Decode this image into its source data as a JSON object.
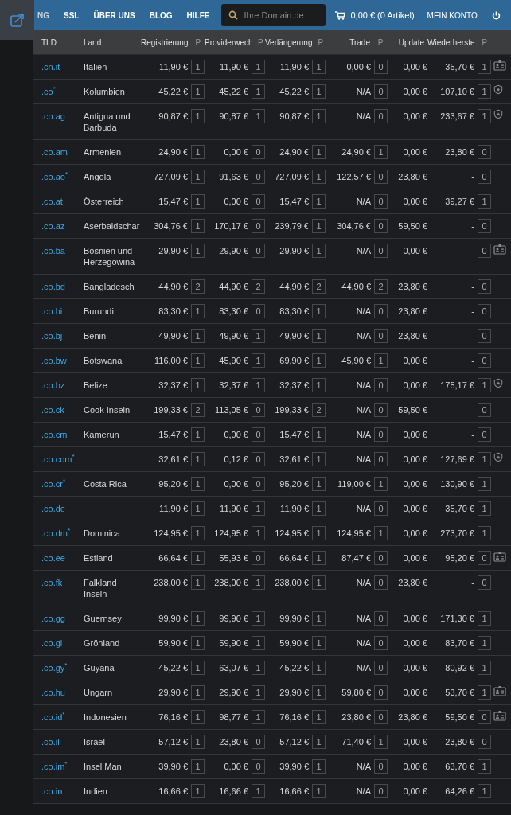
{
  "nav": {
    "items": [
      "NG",
      "SSL",
      "ÜBER UNS",
      "BLOG",
      "HILFE"
    ],
    "search": {
      "placeholder": "Ihre Domain.de"
    },
    "cart": "0,00 € (0 Artikel)",
    "account": "MEIN KONTO"
  },
  "table": {
    "columns": [
      {
        "label": "TLD",
        "kind": "text"
      },
      {
        "label": "Land",
        "kind": "text"
      },
      {
        "label": "Registrierung",
        "p": "P",
        "kind": "price"
      },
      {
        "label": "Providerwech",
        "p": "P",
        "kind": "price"
      },
      {
        "label": "Verlängerung",
        "p": "P",
        "kind": "price"
      },
      {
        "label": "Trade",
        "p": "P",
        "kind": "price"
      },
      {
        "label": "Update",
        "kind": "plain"
      },
      {
        "label": "Wiederherste",
        "p": "P",
        "kind": "price"
      }
    ],
    "rows": [
      {
        "tld": ".cn.it",
        "land": "Italien",
        "prices": [
          [
            "11,90 €",
            "1"
          ],
          [
            "11,90 €",
            "1"
          ],
          [
            "11,90 €",
            "1"
          ],
          [
            "0,00 €",
            "0"
          ]
        ],
        "update": "0,00 €",
        "restore": [
          "35,70 €",
          "1"
        ],
        "kind": "card"
      },
      {
        "tld": ".co$^{*}$",
        "land": "Kolumbien",
        "prices": [
          [
            "45,22 €",
            "1"
          ],
          [
            "45,22 €",
            "1"
          ],
          [
            "45,22 €",
            "1"
          ],
          [
            "N/A",
            "0"
          ]
        ],
        "update": "0,00 €",
        "restore": [
          "107,10 €",
          "1"
        ],
        "kind": "shield"
      },
      {
        "tld": ".co.ag",
        "land": "Antigua und Barbuda",
        "prices": [
          [
            "90,87 €",
            "1"
          ],
          [
            "90,87 €",
            "1"
          ],
          [
            "90,87 €",
            "1"
          ],
          [
            "N/A",
            "0"
          ]
        ],
        "update": "0,00 €",
        "restore": [
          "233,67 €",
          "1"
        ],
        "kind": "shield"
      },
      {
        "tld": ".co.am",
        "land": "Armenien",
        "prices": [
          [
            "24,90 €",
            "1"
          ],
          [
            "0,00 €",
            "0"
          ],
          [
            "24,90 €",
            "1"
          ],
          [
            "24,90 €",
            "1"
          ]
        ],
        "update": "0,00 €",
        "restore": [
          "23,80 €",
          "0"
        ],
        "kind": "plain"
      },
      {
        "tld": ".co.ao$^{*}$",
        "land": "Angola",
        "prices": [
          [
            "727,09 €",
            "1"
          ],
          [
            "91,63 €",
            "0"
          ],
          [
            "727,09 €",
            "1"
          ],
          [
            "122,57 €",
            "0"
          ]
        ],
        "update": "23,80 €",
        "restore": [
          "-",
          "0"
        ],
        "kind": "plain"
      },
      {
        "tld": ".co.at",
        "land": "Österreich",
        "prices": [
          [
            "15,47 €",
            "1"
          ],
          [
            "0,00 €",
            "0"
          ],
          [
            "15,47 €",
            "1"
          ],
          [
            "N/A",
            "0"
          ]
        ],
        "update": "0,00 €",
        "restore": [
          "39,27 €",
          "1"
        ],
        "kind": "plain"
      },
      {
        "tld": ".co.az",
        "land": "Aserbaidschar",
        "prices": [
          [
            "304,76 €",
            "1"
          ],
          [
            "170,17 €",
            "0"
          ],
          [
            "239,79 €",
            "1"
          ],
          [
            "304,76 €",
            "0"
          ]
        ],
        "update": "59,50 €",
        "restore": [
          "-",
          "0"
        ],
        "kind": "plain"
      },
      {
        "tld": ".co.ba",
        "land": "Bosnien und Herzegowina",
        "prices": [
          [
            "29,90 €",
            "1"
          ],
          [
            "29,90 €",
            "0"
          ],
          [
            "29,90 €",
            "1"
          ],
          [
            "N/A",
            "0"
          ]
        ],
        "update": "0,00 €",
        "restore": [
          "-",
          "0"
        ],
        "kind": "card"
      },
      {
        "tld": ".co.bd",
        "land": "Bangladesch",
        "prices": [
          [
            "44,90 €",
            "2"
          ],
          [
            "44,90 €",
            "2"
          ],
          [
            "44,90 €",
            "2"
          ],
          [
            "44,90 €",
            "2"
          ]
        ],
        "update": "23,80 €",
        "restore": [
          "-",
          "0"
        ],
        "kind": "plain"
      },
      {
        "tld": ".co.bi",
        "land": "Burundi",
        "prices": [
          [
            "83,30 €",
            "1"
          ],
          [
            "83,30 €",
            "0"
          ],
          [
            "83,30 €",
            "1"
          ],
          [
            "N/A",
            "0"
          ]
        ],
        "update": "23,80 €",
        "restore": [
          "-",
          "0"
        ],
        "kind": "plain"
      },
      {
        "tld": ".co.bj",
        "land": "Benin",
        "prices": [
          [
            "49,90 €",
            "1"
          ],
          [
            "49,90 €",
            "1"
          ],
          [
            "49,90 €",
            "1"
          ],
          [
            "N/A",
            "0"
          ]
        ],
        "update": "23,80 €",
        "restore": [
          "-",
          "0"
        ],
        "kind": "plain"
      },
      {
        "tld": ".co.bw",
        "land": "Botswana",
        "prices": [
          [
            "116,00 €",
            "1"
          ],
          [
            "45,90 €",
            "1"
          ],
          [
            "69,90 €",
            "1"
          ],
          [
            "45,90 €",
            "1"
          ]
        ],
        "update": "0,00 €",
        "restore": [
          "-",
          "0"
        ],
        "kind": "plain"
      },
      {
        "tld": ".co.bz",
        "land": "Belize",
        "prices": [
          [
            "32,37 €",
            "1"
          ],
          [
            "32,37 €",
            "1"
          ],
          [
            "32,37 €",
            "1"
          ],
          [
            "N/A",
            "0"
          ]
        ],
        "update": "0,00 €",
        "restore": [
          "175,17 €",
          "1"
        ],
        "kind": "shield"
      },
      {
        "tld": ".co.ck",
        "land": "Cook Inseln",
        "prices": [
          [
            "199,33 €",
            "2"
          ],
          [
            "113,05 €",
            "0"
          ],
          [
            "199,33 €",
            "2"
          ],
          [
            "N/A",
            "0"
          ]
        ],
        "update": "59,50 €",
        "restore": [
          "-",
          "0"
        ],
        "kind": "plain"
      },
      {
        "tld": ".co.cm",
        "land": "Kamerun",
        "prices": [
          [
            "15,47 €",
            "1"
          ],
          [
            "0,00 €",
            "0"
          ],
          [
            "15,47 €",
            "1"
          ],
          [
            "N/A",
            "0"
          ]
        ],
        "update": "0,00 €",
        "restore": [
          "-",
          "0"
        ],
        "kind": "plain"
      },
      {
        "tld": ".co.com$^{*}$",
        "prices": [
          [
            "32,61 €",
            "1"
          ],
          [
            "0,12 €",
            "0"
          ],
          [
            "32,61 €",
            "1"
          ],
          [
            "N/A",
            "0"
          ]
        ],
        "update": "0,00 €",
        "restore": [
          "127,69 €",
          "1"
        ],
        "kind": "shield"
      },
      {
        "tld": ".co.cr$^{*}$",
        "land": "Costa Rica",
        "prices": [
          [
            "95,20 €",
            "1"
          ],
          [
            "0,00 €",
            "0"
          ],
          [
            "95,20 €",
            "1"
          ],
          [
            "119,00 €",
            "1"
          ]
        ],
        "update": "0,00 €",
        "restore": [
          "130,90 €",
          "1"
        ],
        "kind": "plain"
      },
      {
        "tld": ".co.de",
        "prices": [
          [
            "11,90 €",
            "1"
          ],
          [
            "11,90 €",
            "1"
          ],
          [
            "11,90 €",
            "1"
          ],
          [
            "N/A",
            "0"
          ]
        ],
        "update": "0,00 €",
        "restore": [
          "35,70 €",
          "1"
        ],
        "kind": "plain"
      },
      {
        "tld": ".co.dm$^{*}$",
        "land": "Dominica",
        "prices": [
          [
            "124,95 €",
            "1"
          ],
          [
            "124,95 €",
            "1"
          ],
          [
            "124,95 €",
            "1"
          ],
          [
            "124,95 €",
            "1"
          ]
        ],
        "update": "0,00 €",
        "restore": [
          "273,70 €",
          "1"
        ],
        "kind": "plain"
      },
      {
        "tld": ".co.ee",
        "land": "Estland",
        "prices": [
          [
            "66,64 €",
            "1"
          ],
          [
            "55,93 €",
            "0"
          ],
          [
            "66,64 €",
            "1"
          ],
          [
            "87,47 €",
            "0"
          ]
        ],
        "update": "0,00 €",
        "restore": [
          "95,20 €",
          "0"
        ],
        "kind": "card"
      },
      {
        "tld": ".co.fk",
        "land": "Falkland Inseln",
        "prices": [
          [
            "238,00 €",
            "1"
          ],
          [
            "238,00 €",
            "1"
          ],
          [
            "238,00 €",
            "1"
          ],
          [
            "N/A",
            "0"
          ]
        ],
        "update": "23,80 €",
        "restore": [
          "-",
          "0"
        ],
        "kind": "plain"
      },
      {
        "tld": ".co.gg",
        "land": "Guernsey",
        "prices": [
          [
            "99,90 €",
            "1"
          ],
          [
            "99,90 €",
            "1"
          ],
          [
            "99,90 €",
            "1"
          ],
          [
            "N/A",
            "0"
          ]
        ],
        "update": "0,00 €",
        "restore": [
          "171,30 €",
          "1"
        ],
        "kind": "plain"
      },
      {
        "tld": ".co.gl",
        "land": "Grönland",
        "prices": [
          [
            "59,90 €",
            "1"
          ],
          [
            "59,90 €",
            "1"
          ],
          [
            "59,90 €",
            "1"
          ],
          [
            "N/A",
            "0"
          ]
        ],
        "update": "0,00 €",
        "restore": [
          "83,70 €",
          "1"
        ],
        "kind": "plain"
      },
      {
        "tld": ".co.gy$^{*}$",
        "land": "Guyana",
        "prices": [
          [
            "45,22 €",
            "1"
          ],
          [
            "63,07 €",
            "1"
          ],
          [
            "45,22 €",
            "1"
          ],
          [
            "N/A",
            "0"
          ]
        ],
        "update": "0,00 €",
        "restore": [
          "80,92 €",
          "1"
        ],
        "kind": "plain"
      },
      {
        "tld": ".co.hu",
        "land": "Ungarn",
        "prices": [
          [
            "29,90 €",
            "1"
          ],
          [
            "29,90 €",
            "1"
          ],
          [
            "29,90 €",
            "1"
          ],
          [
            "59,80 €",
            "0"
          ]
        ],
        "update": "0,00 €",
        "restore": [
          "53,70 €",
          "1"
        ],
        "kind": "card"
      },
      {
        "tld": ".co.id$^{*}$",
        "land": "Indonesien",
        "prices": [
          [
            "76,16 €",
            "1"
          ],
          [
            "98,77 €",
            "1"
          ],
          [
            "76,16 €",
            "1"
          ],
          [
            "23,80 €",
            "0"
          ]
        ],
        "update": "23,80 €",
        "restore": [
          "59,50 €",
          "0"
        ],
        "kind": "card"
      },
      {
        "tld": ".co.il",
        "land": "Israel",
        "prices": [
          [
            "57,12 €",
            "1"
          ],
          [
            "23,80 €",
            "0"
          ],
          [
            "57,12 €",
            "1"
          ],
          [
            "71,40 €",
            "1"
          ]
        ],
        "update": "0,00 €",
        "restore": [
          "23,80 €",
          "0"
        ],
        "kind": "plain"
      },
      {
        "tld": ".co.im$^{*}$",
        "land": "Insel Man",
        "prices": [
          [
            "39,90 €",
            "1"
          ],
          [
            "0,00 €",
            "0"
          ],
          [
            "39,90 €",
            "1"
          ],
          [
            "N/A",
            "0"
          ]
        ],
        "update": "0,00 €",
        "restore": [
          "63,70 €",
          "1"
        ],
        "kind": "plain"
      },
      {
        "tld": ".co.in",
        "land": "Indien",
        "prices": [
          [
            "16,66 €",
            "1"
          ],
          [
            "16,66 €",
            "1"
          ],
          [
            "16,66 €",
            "1"
          ],
          [
            "N/A",
            "0"
          ]
        ],
        "update": "0,00 €",
        "restore": [
          "64,26 €",
          "1"
        ],
        "kind": "plain"
      }
    ]
  }
}
